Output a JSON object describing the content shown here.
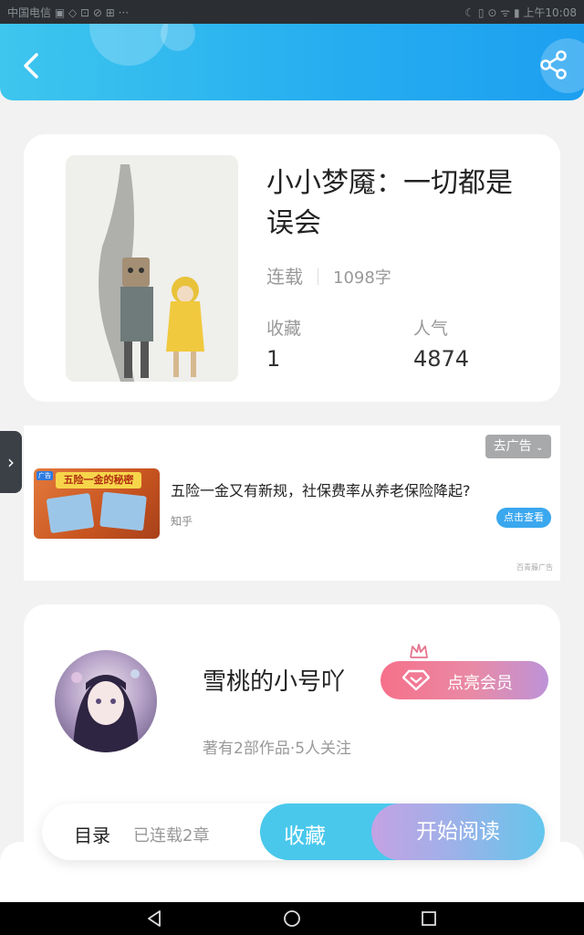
{
  "status_bar": {
    "left_text": "中国电信 ▣ ◇ ⊡ ⊘ ⊞ ···",
    "right_text": "☾ ▯ ⊙ ᯤ ▮ 上午10:08"
  },
  "book": {
    "title": "小小梦魇：一切都是误会",
    "status": "连载",
    "words": "1098字",
    "stats": [
      {
        "label": "收藏",
        "value": "1"
      },
      {
        "label": "人气",
        "value": "4874"
      }
    ]
  },
  "ad": {
    "remove_label": "去广告",
    "image_banner": "五险一金的秘密",
    "image_tag": "广告",
    "title": "五险一金又有新规，社保费率从养老保险降起?",
    "source": "知乎",
    "cta": "点击查看",
    "brand": "百青藤广告"
  },
  "author": {
    "name": "雪桃的小号吖",
    "info": "著有2部作品·5人关注",
    "vip_button": "点亮会员"
  },
  "action_bar": {
    "catalog": "目录",
    "chapters": "已连载2章",
    "favorite": "收藏",
    "read": "开始阅读"
  },
  "colors": {
    "header_start": "#3ec6ee",
    "header_end": "#1d9ff0",
    "favorite_button": "#49c8ec",
    "vip_gradient_start": "#f6708a",
    "read_gradient_start": "#c4a2e4"
  },
  "icons": [
    "back-icon",
    "share-icon",
    "chevron-right-icon",
    "chevron-down-icon",
    "crown-icon",
    "diamond-icon"
  ]
}
